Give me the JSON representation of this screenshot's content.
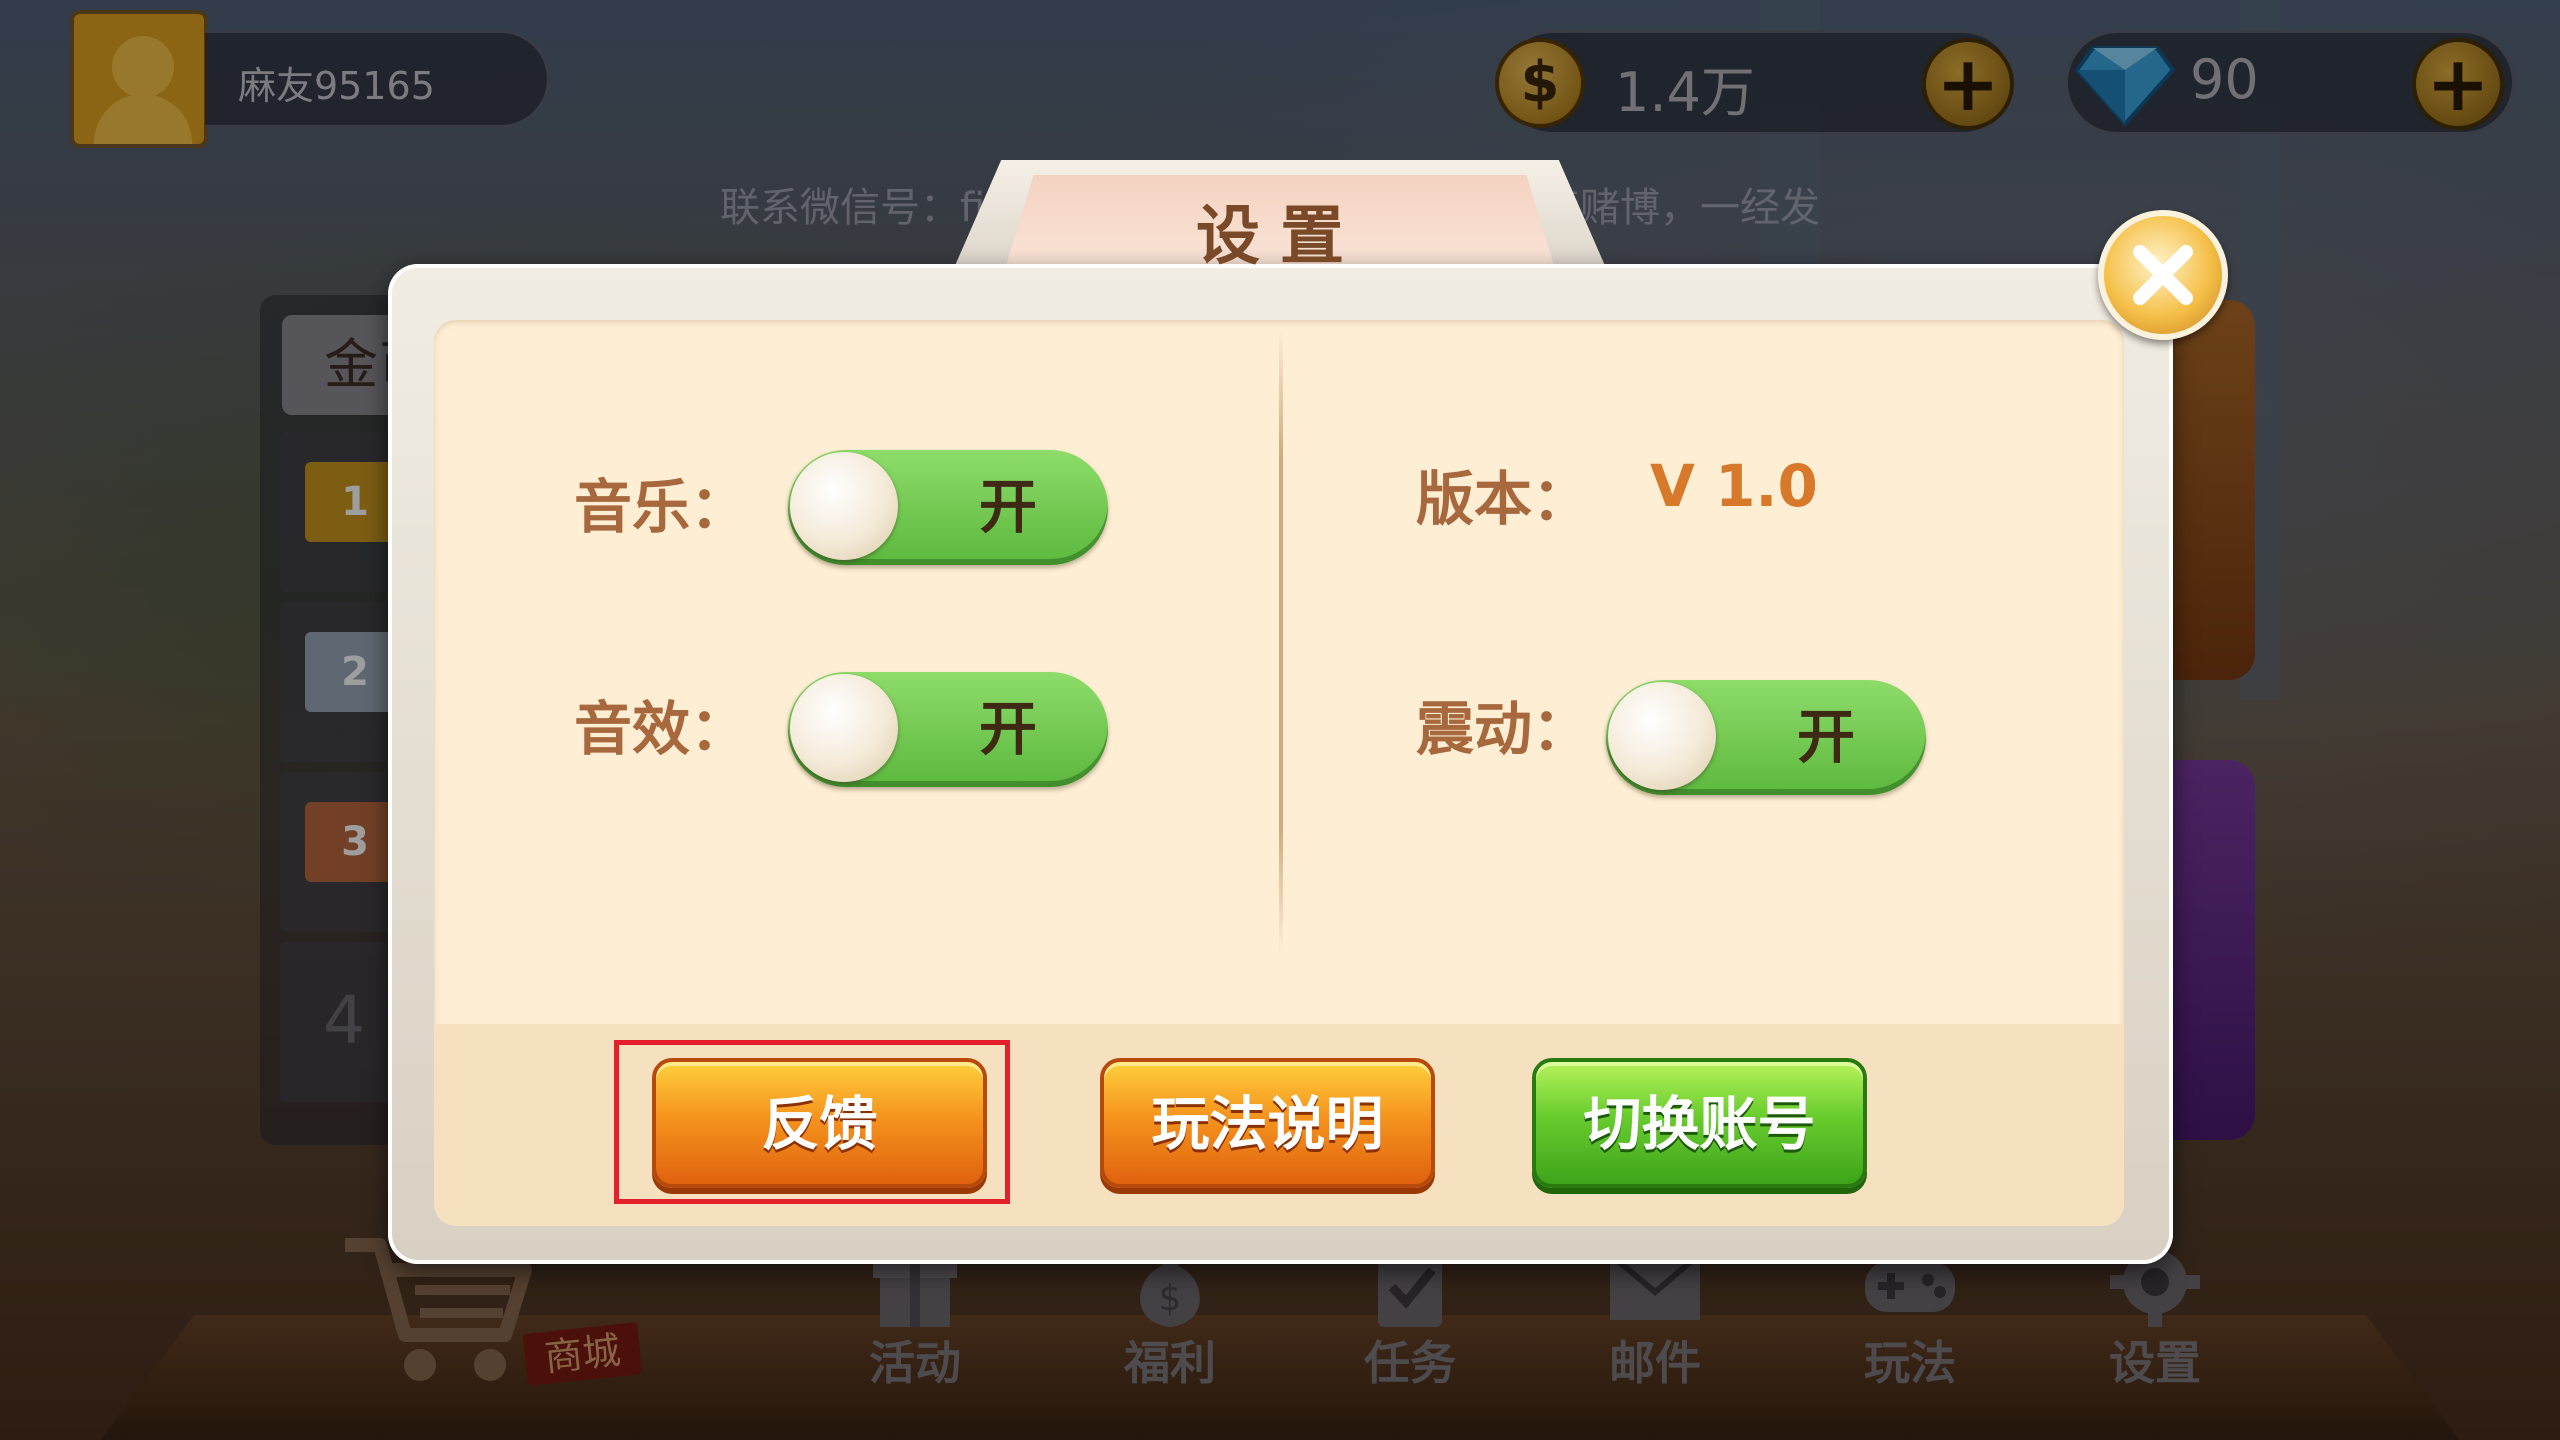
{
  "top_bar": {
    "player_name": "麻友95165",
    "coins": "1.4万",
    "gems": "90"
  },
  "notice": {
    "left_fragment": "联系微信号：fis",
    "right_fragment": "禁赌博，一经发"
  },
  "rank_panel": {
    "tab_label": "金币",
    "ranks": [
      "1",
      "2",
      "3",
      "4"
    ]
  },
  "bottom_nav": {
    "shop_label": "商城",
    "items": [
      {
        "label": "活动",
        "icon": "gift-icon"
      },
      {
        "label": "福利",
        "icon": "money-bag-icon"
      },
      {
        "label": "任务",
        "icon": "task-clipboard-icon"
      },
      {
        "label": "邮件",
        "icon": "mail-icon"
      },
      {
        "label": "玩法",
        "icon": "gamepad-icon"
      },
      {
        "label": "设置",
        "icon": "gear-icon"
      }
    ]
  },
  "settings_dialog": {
    "title": "设置",
    "music": {
      "label": "音乐：",
      "state": "开",
      "on": true
    },
    "sound_effects": {
      "label": "音效：",
      "state": "开",
      "on": true
    },
    "version": {
      "label": "版本：",
      "value": "V 1.0"
    },
    "vibration": {
      "label": "震动：",
      "state": "开",
      "on": true
    },
    "buttons": {
      "feedback": "反馈",
      "rules": "玩法说明",
      "switch_account": "切换账号"
    },
    "close_icon": "close-x-icon"
  },
  "colors": {
    "label_brown": "#a8683e",
    "version_orange": "#d8782a",
    "toggle_green": "#5cb83e",
    "button_orange": "#f5941e",
    "button_green": "#68cc2e",
    "highlight_red": "#e5202a",
    "panel_cream": "#fdeed4"
  }
}
